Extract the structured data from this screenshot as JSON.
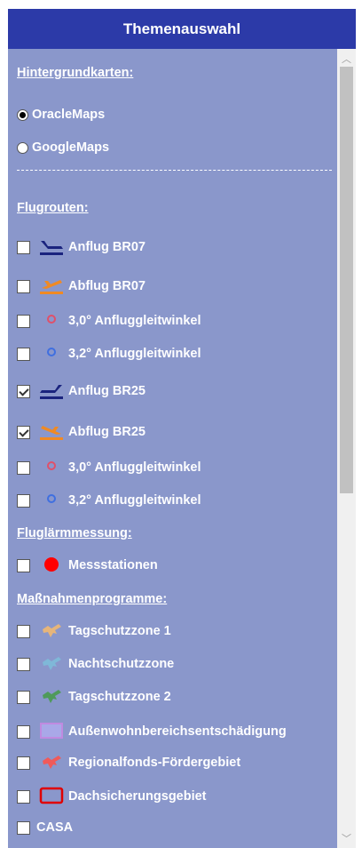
{
  "header": {
    "title": "Themenauswahl"
  },
  "sections": {
    "hintergrund": "Hintergrundkarten:",
    "flugrouten": "Flugrouten:",
    "fluglaerm": "Fluglärmmessung:",
    "massnahmen": "Maßnahmenprogramme:"
  },
  "basemaps": [
    {
      "label": "OracleMaps",
      "selected": true
    },
    {
      "label": "GoogleMaps",
      "selected": false
    }
  ],
  "separator": "---------------------------------------------------------",
  "routes": [
    {
      "label": "Anflug BR07",
      "checked": false,
      "icon": "landing-plane-icon",
      "color": "#1a237e"
    },
    {
      "label": "Abflug BR07",
      "checked": false,
      "icon": "takeoff-plane-icon",
      "color": "#f08a24"
    },
    {
      "label": "3,0° Anfluggleitwinkel",
      "checked": false,
      "icon": "circle-red-icon",
      "color": "#e0506a"
    },
    {
      "label": "3,2° Anfluggleitwinkel",
      "checked": false,
      "icon": "circle-blue-icon",
      "color": "#3f6fe0"
    },
    {
      "label": "Anflug BR25",
      "checked": true,
      "icon": "landing-plane-icon",
      "color": "#1a237e"
    },
    {
      "label": "Abflug BR25",
      "checked": true,
      "icon": "takeoff-plane-icon",
      "color": "#f08a24"
    },
    {
      "label": "3,0° Anfluggleitwinkel",
      "checked": false,
      "icon": "circle-red-icon",
      "color": "#e0506a"
    },
    {
      "label": "3,2° Anfluggleitwinkel",
      "checked": false,
      "icon": "circle-blue-icon",
      "color": "#3f6fe0"
    }
  ],
  "noise": [
    {
      "label": "Messstationen",
      "checked": false,
      "icon": "red-dot-icon",
      "color": "#ff0000"
    }
  ],
  "programs": [
    {
      "label": "Tagschutzzone 1",
      "checked": false,
      "icon": "zone-shape-icon",
      "color": "#e6b57a"
    },
    {
      "label": "Nachtschutzzone",
      "checked": false,
      "icon": "zone-shape-icon",
      "color": "#7fb8d8"
    },
    {
      "label": "Tagschutzzone 2",
      "checked": false,
      "icon": "zone-shape-icon",
      "color": "#4f9a5a"
    },
    {
      "label": "Außenwohnbereichsentschädigung",
      "checked": false,
      "icon": "purple-rect-icon",
      "color": "#c08ae0"
    },
    {
      "label": "Regionalfonds-Fördergebiet",
      "checked": false,
      "icon": "zone-shape-icon",
      "color": "#f05a5a"
    },
    {
      "label": "Dachsicherungsgebiet",
      "checked": false,
      "icon": "red-rect-icon",
      "color": "#e00000"
    },
    {
      "label": "CASA",
      "checked": false,
      "icon": "none"
    }
  ]
}
